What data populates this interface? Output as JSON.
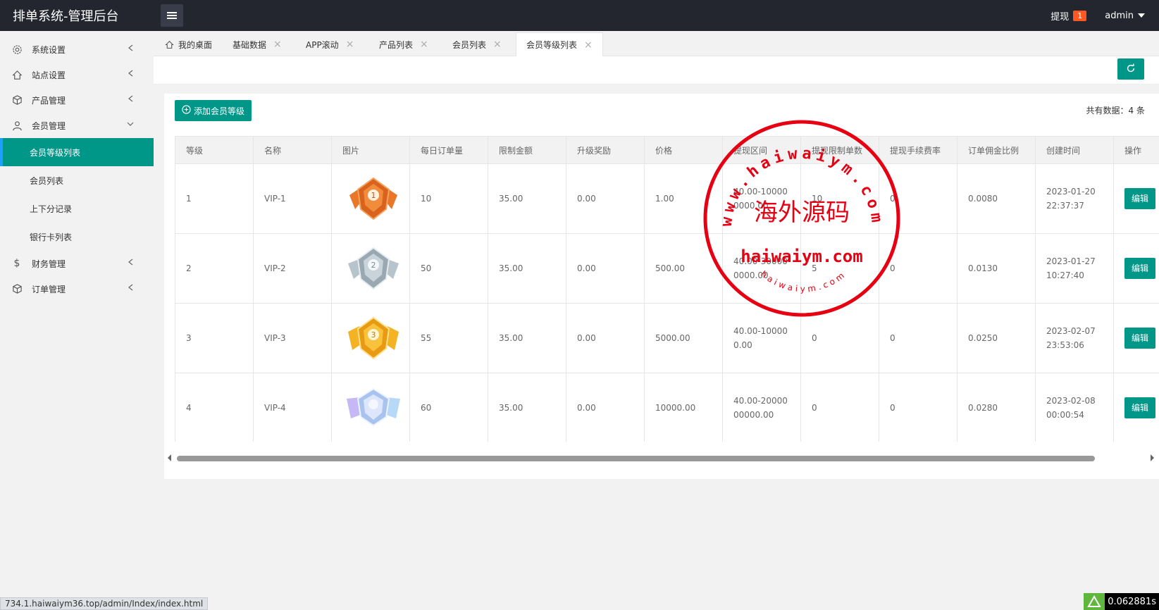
{
  "header": {
    "brand": "排单系统-管理后台",
    "withdraw_label": "提现",
    "withdraw_badge": "1",
    "user": "admin"
  },
  "sidebar": {
    "items": [
      {
        "label": "系统设置",
        "icon": "gear-icon"
      },
      {
        "label": "站点设置",
        "icon": "home-icon"
      },
      {
        "label": "产品管理",
        "icon": "cubes-icon"
      },
      {
        "label": "会员管理",
        "icon": "user-icon"
      },
      {
        "label": "财务管理",
        "icon": "dollar-icon"
      },
      {
        "label": "订单管理",
        "icon": "cubes-icon"
      }
    ],
    "sub_items": [
      "会员等级列表",
      "会员列表",
      "上下分记录",
      "银行卡列表"
    ]
  },
  "tabs": [
    "我的桌面",
    "基础数据",
    "APP滚动",
    "产品列表",
    "会员列表",
    "会员等级列表"
  ],
  "toolbar": {
    "add_label": "添加会员等级",
    "count_text": "共有数据：4 条"
  },
  "table": {
    "columns": [
      "等级",
      "名称",
      "图片",
      "每日订单量",
      "限制金额",
      "升级奖励",
      "价格",
      "提现区间",
      "提现限制单数",
      "提现手续费率",
      "订单佣金比例",
      "创建时间",
      "操作"
    ],
    "rows": [
      {
        "level": "1",
        "name": "VIP-1",
        "medal": "bronze",
        "daily": "10",
        "limit": "35.00",
        "reward": "0.00",
        "price": "1.00",
        "range": "40.00-100000000.00",
        "wd_count": "10",
        "fee": "0",
        "commission": "0.0080",
        "created": "2023-01-20 22:37:37",
        "action": "编辑"
      },
      {
        "level": "2",
        "name": "VIP-2",
        "medal": "silver",
        "daily": "50",
        "limit": "35.00",
        "reward": "0.00",
        "price": "500.00",
        "range": "40.00-300000000.00",
        "wd_count": "5",
        "fee": "0",
        "commission": "0.0130",
        "created": "2023-01-27 10:27:40",
        "action": "编辑"
      },
      {
        "level": "3",
        "name": "VIP-3",
        "medal": "gold",
        "daily": "55",
        "limit": "35.00",
        "reward": "0.00",
        "price": "5000.00",
        "range": "40.00-100000.00",
        "wd_count": "0",
        "fee": "0",
        "commission": "0.0250",
        "created": "2023-02-07 23:53:06",
        "action": "编辑"
      },
      {
        "level": "4",
        "name": "VIP-4",
        "medal": "platinum",
        "daily": "60",
        "limit": "35.00",
        "reward": "0.00",
        "price": "10000.00",
        "range": "40.00-2000000000.00",
        "wd_count": "0",
        "fee": "0",
        "commission": "0.0280",
        "created": "2023-02-08 00:00:54",
        "action": "编辑"
      }
    ]
  },
  "watermark": {
    "top_arc": "www.haiwaiym.com",
    "center": "海外源码",
    "domain": "haiwaiym.com",
    "bottom_arc": "haiwaiym.com"
  },
  "status": {
    "url": "734.1.haiwaiym36.top/admin/Index/index.html",
    "timer": "0.062881s"
  },
  "colors": {
    "accent": "#009688",
    "topbar": "#23262e",
    "badge": "#ff5722",
    "stamp": "#e60012"
  }
}
